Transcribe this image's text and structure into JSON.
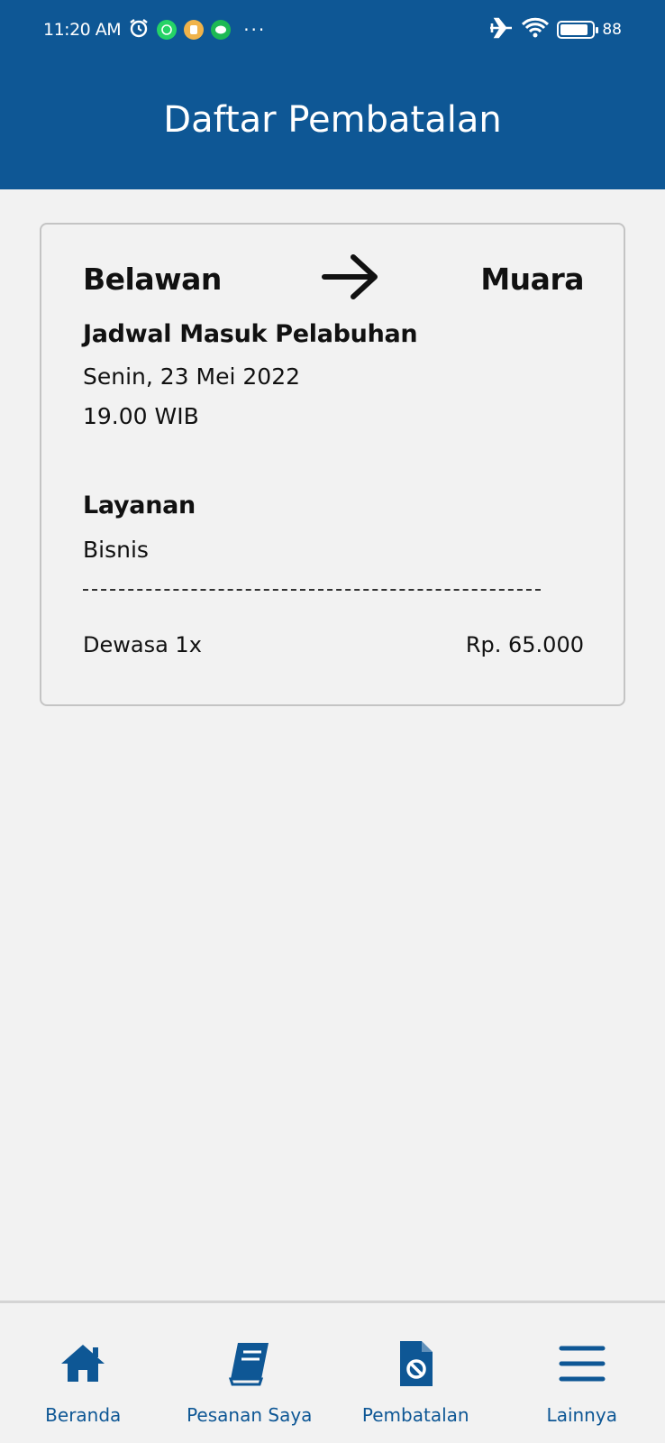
{
  "status_bar": {
    "time": "11:20 AM",
    "more": "···",
    "battery_percent": "88",
    "battery_level": 0.88
  },
  "header": {
    "title": "Daftar Pembatalan"
  },
  "card": {
    "origin": "Belawan",
    "destination": "Muara",
    "schedule_label": "Jadwal Masuk Pelabuhan",
    "schedule_date": "Senin, 23 Mei 2022",
    "schedule_time": "19.00 WIB",
    "service_label": "Layanan",
    "service_value": "Bisnis",
    "passenger": "Dewasa 1x",
    "price": "Rp. 65.000"
  },
  "nav": {
    "items": [
      {
        "label": "Beranda",
        "icon": "home-icon"
      },
      {
        "label": "Pesanan Saya",
        "icon": "book-icon"
      },
      {
        "label": "Pembatalan",
        "icon": "cancel-document-icon"
      },
      {
        "label": "Lainnya",
        "icon": "menu-icon"
      }
    ]
  },
  "colors": {
    "primary": "#0e5795",
    "background": "#f2f2f2",
    "card_border": "#c4c4c4"
  }
}
